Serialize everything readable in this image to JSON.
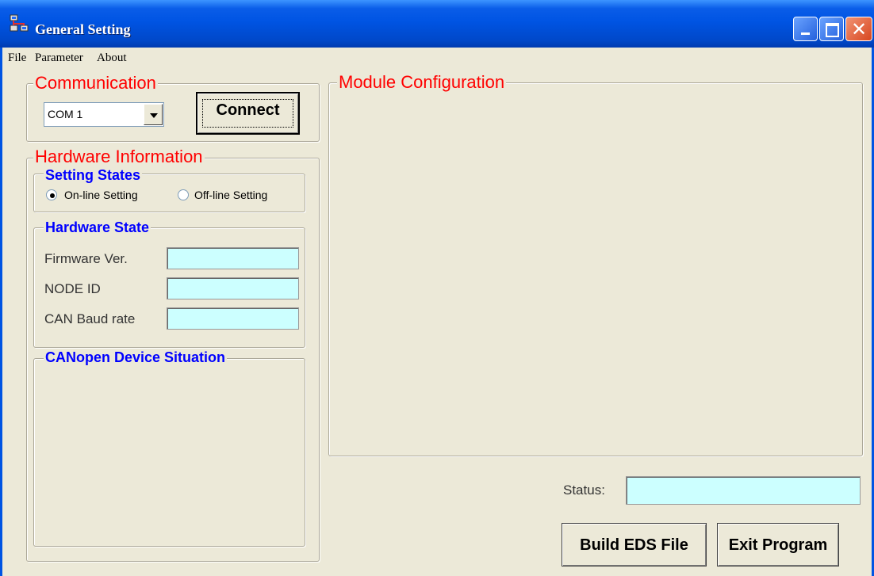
{
  "window": {
    "title": "General Setting"
  },
  "menu": {
    "items": [
      "File",
      "Parameter",
      "About"
    ]
  },
  "communication": {
    "title": "Communication",
    "com_port": "COM 1",
    "connect_label": "Connect"
  },
  "hardware_info": {
    "title": "Hardware Information",
    "setting_states": {
      "title": "Setting States",
      "online_label": "On-line Setting",
      "offline_label": "Off-line Setting",
      "selected": "On-line Setting"
    },
    "hardware_state": {
      "title": "Hardware State",
      "firmware_label": "Firmware Ver.",
      "firmware_value": "",
      "node_id_label": "NODE ID",
      "node_id_value": "",
      "baud_label": "CAN Baud rate",
      "baud_value": ""
    },
    "canopen": {
      "title": "CANopen Device Situation"
    }
  },
  "module_config": {
    "title": "Module Configuration"
  },
  "status": {
    "label": "Status:",
    "value": ""
  },
  "buttons": {
    "build_eds": "Build EDS File",
    "exit": "Exit Program"
  },
  "colors": {
    "title_bar": "#0054e3",
    "section_red": "#ff0000",
    "section_blue": "#0000ff",
    "field_bg": "#ccffff",
    "window_bg": "#ece9d8"
  }
}
